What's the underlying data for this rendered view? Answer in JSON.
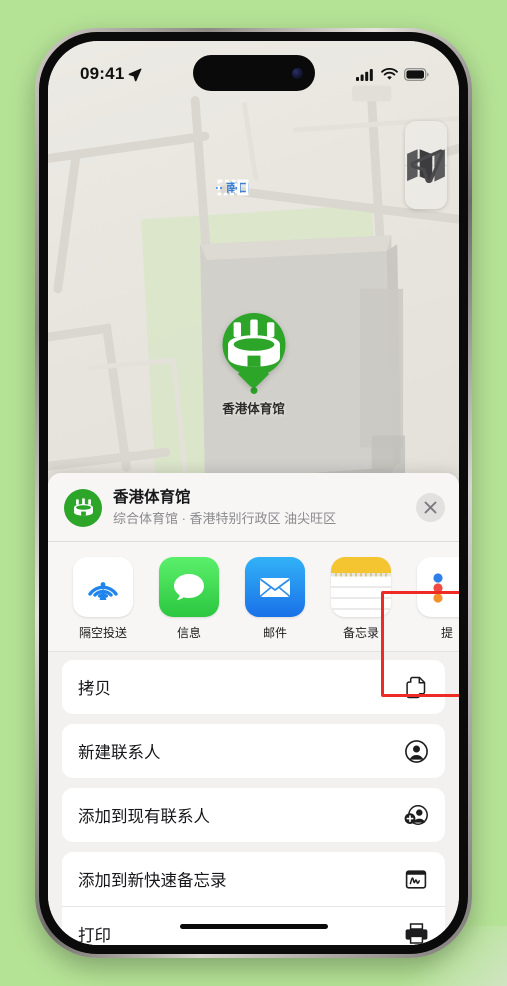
{
  "status_bar": {
    "time": "09:41",
    "location_arrow": "location-arrow",
    "cellular": "signal-bars",
    "wifi": "wifi",
    "battery": "battery-full"
  },
  "map": {
    "controls": [
      {
        "name": "map-layers",
        "icon": "map-icon"
      },
      {
        "name": "locate-me",
        "icon": "navigation-arrow-icon"
      }
    ],
    "transit_label": "南口",
    "poi_label": "香港体育馆",
    "poi_icon": "stadium-icon"
  },
  "share_sheet": {
    "title": "香港体育馆",
    "subtitle": "综合体育馆 · 香港特别行政区 油尖旺区",
    "header_icon": "stadium-icon",
    "close_label": "×",
    "apps": [
      {
        "label": "隔空投送",
        "icon": "airdrop-icon"
      },
      {
        "label": "信息",
        "icon": "messages-icon"
      },
      {
        "label": "邮件",
        "icon": "mail-icon"
      },
      {
        "label": "备忘录",
        "icon": "notes-icon"
      },
      {
        "label": "提",
        "icon": "reminders-icon"
      }
    ],
    "highlighted_app": "备忘录",
    "highlight_color": "#ee2a24",
    "actions": [
      {
        "label": "拷贝",
        "icon": "copy-icon"
      },
      {
        "label": "新建联系人",
        "icon": "person-circle-icon"
      },
      {
        "label": "添加到现有联系人",
        "icon": "person-add-icon"
      },
      {
        "label": "添加到新快速备忘录",
        "icon": "quick-note-icon"
      },
      {
        "label": "打印",
        "icon": "printer-icon"
      }
    ]
  },
  "colors": {
    "background": "#b5e396",
    "accent_green": "#2ca529",
    "highlight_red": "#ee2a24",
    "sheet_bg": "#f2f1ef"
  }
}
